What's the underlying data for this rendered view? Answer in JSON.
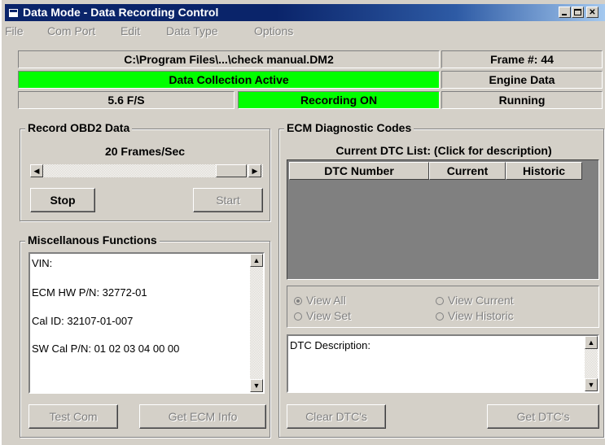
{
  "window": {
    "title": "Data Mode - Data Recording Control"
  },
  "menu": [
    {
      "label": "File"
    },
    {
      "label": "Com Port"
    },
    {
      "label": "Edit"
    },
    {
      "label": "Data Type"
    },
    {
      "label": "Options"
    }
  ],
  "status": {
    "file_path": "C:\\Program Files\\...\\check manual.DM2",
    "frame": "Frame #: 44",
    "collection": "Data Collection Active",
    "data_kind": "Engine Data",
    "rate": "5.6 F/S",
    "recording": "Recording ON",
    "engine_state": "Running"
  },
  "record": {
    "title": "Record OBD2 Data",
    "rate_label": "20 Frames/Sec",
    "stop_label": "Stop",
    "start_label": "Start"
  },
  "misc": {
    "title": "Miscellanous Functions",
    "lines": [
      "VIN:",
      "ECM HW P/N:  32772-01",
      "Cal ID:  32107-01-007",
      "SW Cal P/N:  01 02 03 04 00 00"
    ],
    "test_com_label": "Test Com",
    "get_ecm_label": "Get ECM Info"
  },
  "ecm": {
    "title": "ECM Diagnostic Codes",
    "list_caption": "Current DTC List: (Click for description)",
    "columns": [
      "DTC Number",
      "Current",
      "Historic"
    ],
    "view_options": [
      "View All",
      "View Current",
      "View Set",
      "View Historic"
    ],
    "description_label": "DTC Description:",
    "clear_label": "Clear DTC's",
    "get_label": "Get DTC's"
  },
  "colors": {
    "active": "#00ff00",
    "title_bar": "#0a246a",
    "face": "#d4d0c8"
  }
}
